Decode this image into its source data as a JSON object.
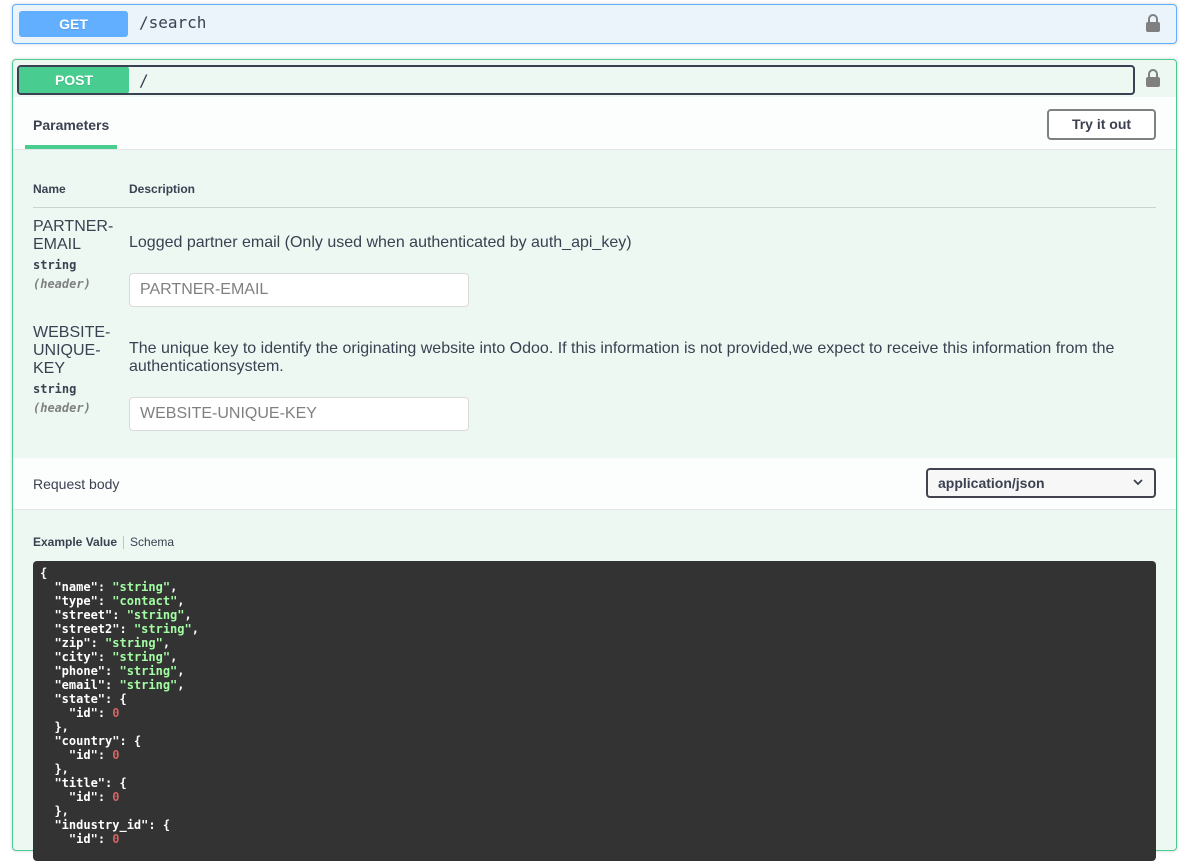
{
  "get_op": {
    "method": "GET",
    "path": "/search",
    "lock_icon": "lock-icon"
  },
  "post_op": {
    "method": "POST",
    "path": "/",
    "lock_icon": "lock-icon",
    "tabs": {
      "parameters": "Parameters"
    },
    "try_button": "Try it out",
    "columns": {
      "name": "Name",
      "description": "Description"
    },
    "parameters": [
      {
        "name_line1": "PARTNER-",
        "name_line2": "EMAIL",
        "name_line3": "",
        "type": "string",
        "in": "(header)",
        "description": "Logged partner email (Only used when authenticated by auth_api_key)",
        "placeholder": "PARTNER-EMAIL"
      },
      {
        "name_line1": "WEBSITE-",
        "name_line2": "UNIQUE-",
        "name_line3": "KEY",
        "type": "string",
        "in": "(header)",
        "description_line1": "The unique key to identify the originating website into Odoo. If this information is not provided,we expect to receive this information from the",
        "description_line2": "authenticationsystem.",
        "placeholder": "WEBSITE-UNIQUE-KEY"
      }
    ],
    "request_body": {
      "label": "Request body",
      "content_type": "application/json"
    },
    "example_tabs": {
      "example_value": "Example Value",
      "schema": "Schema"
    },
    "example_json_lines": [
      [
        [
          "p",
          "{"
        ]
      ],
      [
        [
          "p",
          "  "
        ],
        [
          "k",
          "\"name\""
        ],
        [
          "p",
          ": "
        ],
        [
          "s",
          "\"string\""
        ],
        [
          "p",
          ","
        ]
      ],
      [
        [
          "p",
          "  "
        ],
        [
          "k",
          "\"type\""
        ],
        [
          "p",
          ": "
        ],
        [
          "s",
          "\"contact\""
        ],
        [
          "p",
          ","
        ]
      ],
      [
        [
          "p",
          "  "
        ],
        [
          "k",
          "\"street\""
        ],
        [
          "p",
          ": "
        ],
        [
          "s",
          "\"string\""
        ],
        [
          "p",
          ","
        ]
      ],
      [
        [
          "p",
          "  "
        ],
        [
          "k",
          "\"street2\""
        ],
        [
          "p",
          ": "
        ],
        [
          "s",
          "\"string\""
        ],
        [
          "p",
          ","
        ]
      ],
      [
        [
          "p",
          "  "
        ],
        [
          "k",
          "\"zip\""
        ],
        [
          "p",
          ": "
        ],
        [
          "s",
          "\"string\""
        ],
        [
          "p",
          ","
        ]
      ],
      [
        [
          "p",
          "  "
        ],
        [
          "k",
          "\"city\""
        ],
        [
          "p",
          ": "
        ],
        [
          "s",
          "\"string\""
        ],
        [
          "p",
          ","
        ]
      ],
      [
        [
          "p",
          "  "
        ],
        [
          "k",
          "\"phone\""
        ],
        [
          "p",
          ": "
        ],
        [
          "s",
          "\"string\""
        ],
        [
          "p",
          ","
        ]
      ],
      [
        [
          "p",
          "  "
        ],
        [
          "k",
          "\"email\""
        ],
        [
          "p",
          ": "
        ],
        [
          "s",
          "\"string\""
        ],
        [
          "p",
          ","
        ]
      ],
      [
        [
          "p",
          "  "
        ],
        [
          "k",
          "\"state\""
        ],
        [
          "p",
          ": {"
        ]
      ],
      [
        [
          "p",
          "    "
        ],
        [
          "k",
          "\"id\""
        ],
        [
          "p",
          ": "
        ],
        [
          "n",
          "0"
        ]
      ],
      [
        [
          "p",
          "  },"
        ]
      ],
      [
        [
          "p",
          "  "
        ],
        [
          "k",
          "\"country\""
        ],
        [
          "p",
          ": {"
        ]
      ],
      [
        [
          "p",
          "    "
        ],
        [
          "k",
          "\"id\""
        ],
        [
          "p",
          ": "
        ],
        [
          "n",
          "0"
        ]
      ],
      [
        [
          "p",
          "  },"
        ]
      ],
      [
        [
          "p",
          "  "
        ],
        [
          "k",
          "\"title\""
        ],
        [
          "p",
          ": {"
        ]
      ],
      [
        [
          "p",
          "    "
        ],
        [
          "k",
          "\"id\""
        ],
        [
          "p",
          ": "
        ],
        [
          "n",
          "0"
        ]
      ],
      [
        [
          "p",
          "  },"
        ]
      ],
      [
        [
          "p",
          "  "
        ],
        [
          "k",
          "\"industry_id\""
        ],
        [
          "p",
          ": {"
        ]
      ],
      [
        [
          "p",
          "    "
        ],
        [
          "k",
          "\"id\""
        ],
        [
          "p",
          ": "
        ],
        [
          "n",
          "0"
        ]
      ]
    ]
  },
  "colors": {
    "get": "#61affe",
    "post": "#49cc90",
    "code_bg": "#333333",
    "code_string": "#a2fca2",
    "code_number": "#d36363"
  }
}
